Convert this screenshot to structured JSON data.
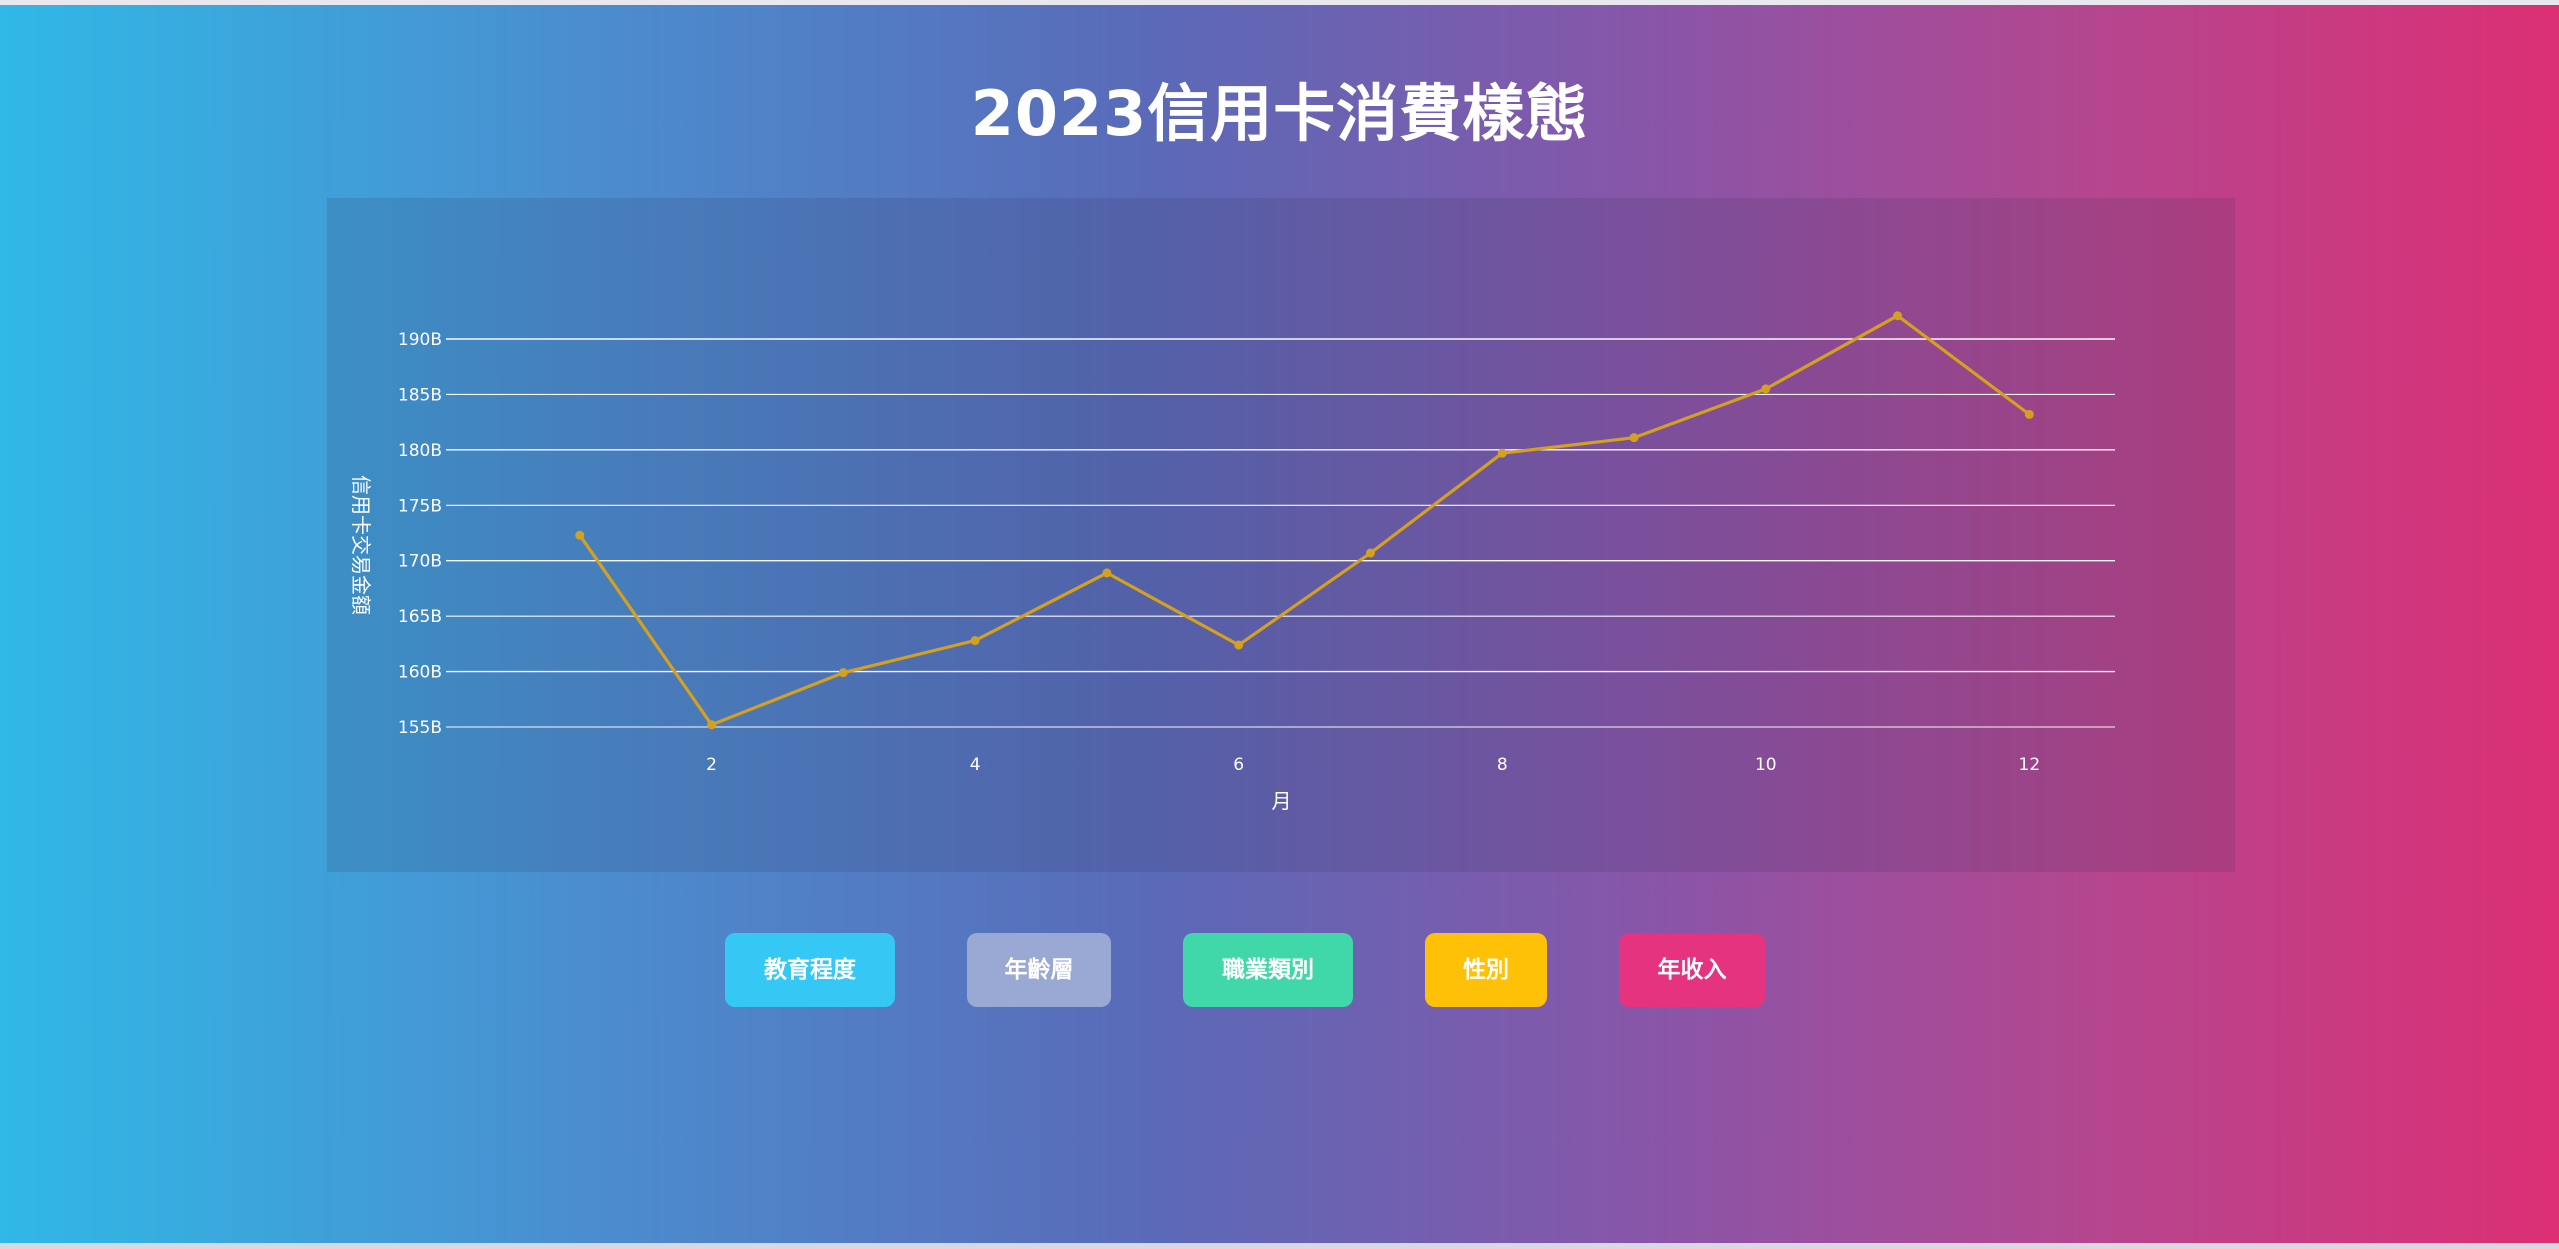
{
  "page": {
    "title": "2023信用卡消費樣態"
  },
  "chart_data": {
    "type": "line",
    "title": "",
    "xlabel": "月",
    "ylabel": "信用卡交易金額",
    "x": [
      1,
      2,
      3,
      4,
      5,
      6,
      7,
      8,
      9,
      10,
      11,
      12
    ],
    "series": [
      {
        "values": [
          172.3,
          155.2,
          159.9,
          162.8,
          168.9,
          162.4,
          170.7,
          179.7,
          181.1,
          185.5,
          192.1,
          183.2
        ],
        "color": "#d4a020"
      }
    ],
    "xticks": [
      2,
      4,
      6,
      8,
      10,
      12
    ],
    "yticks": [
      155,
      160,
      165,
      170,
      175,
      180,
      185,
      190
    ],
    "ytick_labels": [
      "155B",
      "160B",
      "165B",
      "170B",
      "175B",
      "180B",
      "185B",
      "190B"
    ],
    "xlim": [
      0,
      12.65
    ],
    "ylim": [
      155,
      190
    ],
    "grid": true,
    "legend": false
  },
  "filters": {
    "education": {
      "label": "教育程度",
      "color": "#36c8f5"
    },
    "age": {
      "label": "年齡層",
      "color": "#9aa8d4"
    },
    "occupation": {
      "label": "職業類別",
      "color": "#40d8a8"
    },
    "gender": {
      "label": "性別",
      "color": "#ffc107"
    },
    "income": {
      "label": "年收入",
      "color": "#e53380"
    }
  }
}
